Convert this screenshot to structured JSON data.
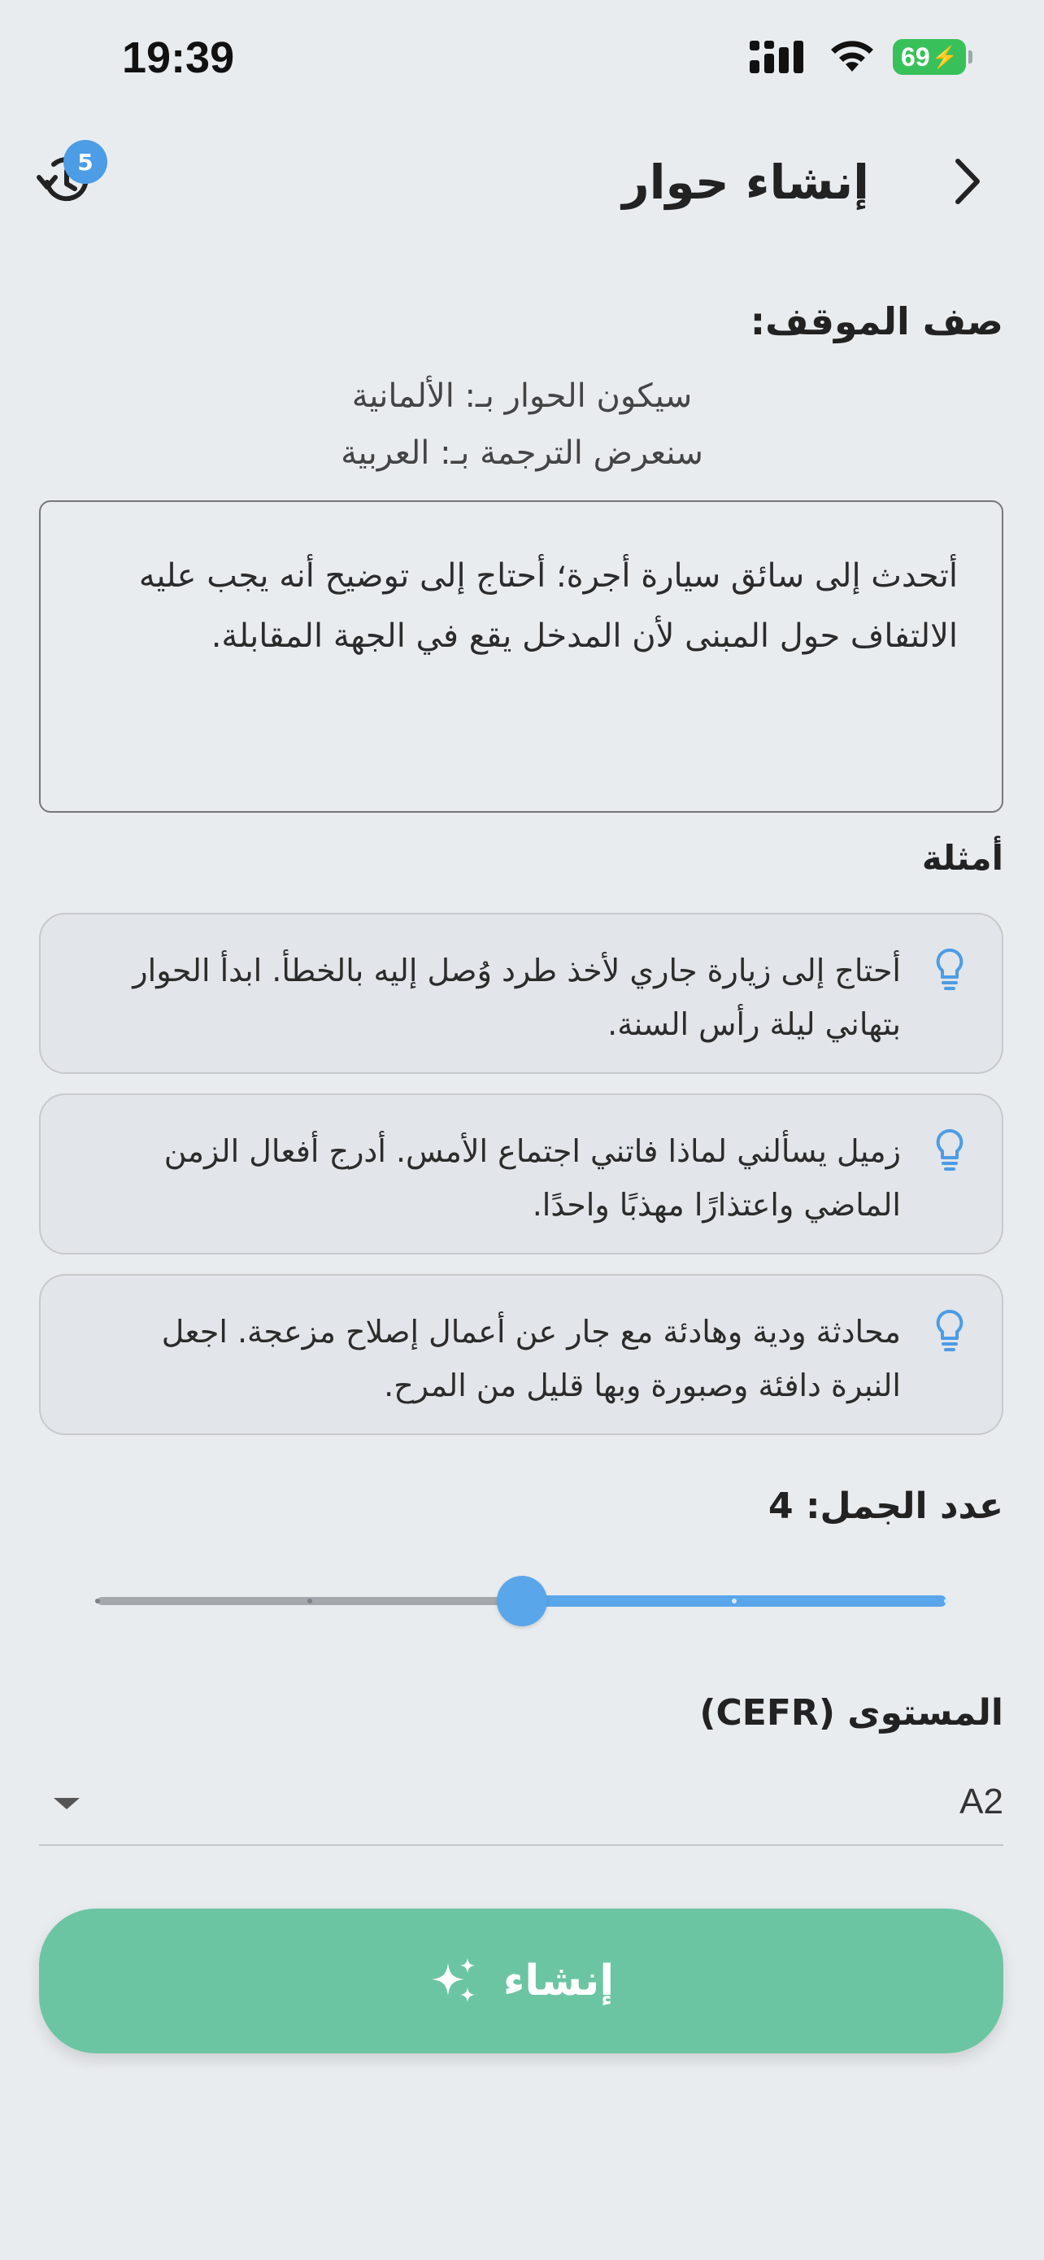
{
  "status_bar": {
    "time": "19:39",
    "battery": "69"
  },
  "header": {
    "title": "إنشاء حوار",
    "history_badge": "5"
  },
  "situation": {
    "label": "صف الموقف:",
    "dialogue_language": "سيكون الحوار بـ: الألمانية",
    "translation_language": "سنعرض الترجمة بـ: العربية",
    "text": "أتحدث إلى سائق سيارة أجرة؛ أحتاج إلى توضيح أنه يجب عليه الالتفاف حول المبنى لأن المدخل يقع في الجهة المقابلة."
  },
  "examples": {
    "label": "أمثلة",
    "items": [
      {
        "text": "أحتاج إلى زيارة جاري لأخذ طرد وُصل إليه بالخطأ. ابدأ الحوار بتهاني ليلة رأس السنة.",
        "icon": "lightbulb-icon"
      },
      {
        "text": "زميل يسألني لماذا فاتني اجتماع الأمس. أدرج أفعال الزمن الماضي واعتذارًا مهذبًا واحدًا.",
        "icon": "lightbulb-icon"
      },
      {
        "text": "محادثة ودية وهادئة مع جار عن أعمال إصلاح مزعجة. اجعل النبرة دافئة وصبورة وبها قليل من المرح.",
        "icon": "lightbulb-icon"
      }
    ]
  },
  "sentences": {
    "label": "عدد الجمل: 4",
    "value": 4,
    "min": 2,
    "max": 6,
    "steps": 5
  },
  "cefr": {
    "label": "المستوى (CEFR)",
    "selected": "A2"
  },
  "create_button": {
    "label": "إنشاء"
  },
  "colors": {
    "accent": "#5aa6ea",
    "button": "#6cc5a2",
    "background": "#e9ecef",
    "battery": "#38c15a"
  }
}
